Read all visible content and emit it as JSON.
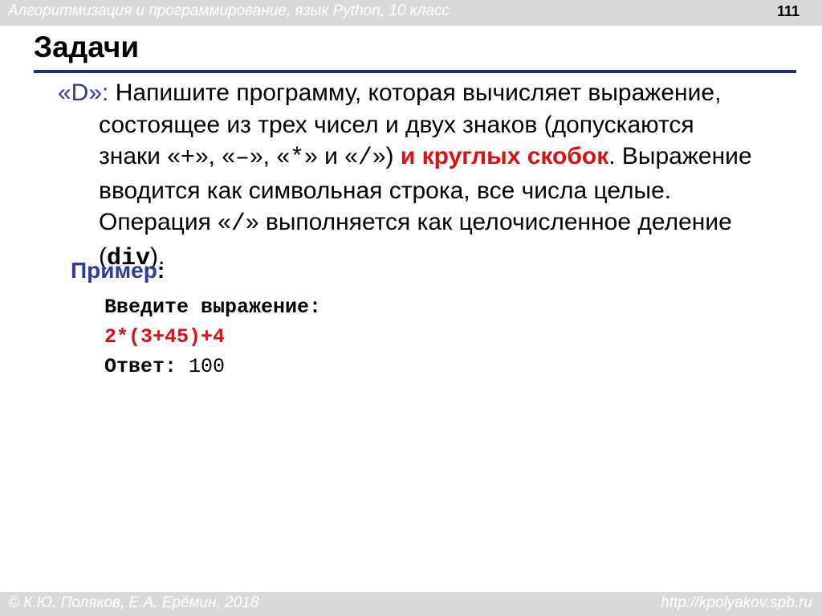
{
  "header": {
    "course": "Алгоритмизация и программирование, язык Python, 10 класс",
    "page_number": "111"
  },
  "title": "Задачи",
  "task": {
    "label": "«D»",
    "colon": ":",
    "line1_text": " Напишите программу, которая вычисляет выражение,",
    "line2": "состоящее из трех чисел и двух знаков (допускаются",
    "line3_a": "знаки «",
    "op_plus": "+",
    "line3_b": "», «",
    "op_minus": "–",
    "line3_c": "», «",
    "op_mul": "*",
    "line3_d": "» и «",
    "op_div": "/",
    "line3_e": "») ",
    "line3_red": "и круглых скобок",
    "line3_f": ". Выражение",
    "line4": "вводится как символьная строка, все числа целые.",
    "line5_a": "Операция «",
    "line5_op": "/",
    "line5_b": "» выполняется как целочисленное деление",
    "line6_a": "(",
    "line6_code": "div",
    "line6_b": ")."
  },
  "example": {
    "label": "Пример",
    "colon": ":",
    "prompt": "Введите выражение:",
    "input": "2*(3+45)+4",
    "answer_label": "Ответ:",
    "answer_value": " 100"
  },
  "footer": {
    "author": "© К.Ю. Поляков, Е.А. Ерёмин, 2018",
    "url": "http://kpolyakov.spb.ru"
  },
  "colors": {
    "accent_blue": "#2e3ba0",
    "highlight_red": "#e01010",
    "band_gray": "#d9d9d9"
  }
}
